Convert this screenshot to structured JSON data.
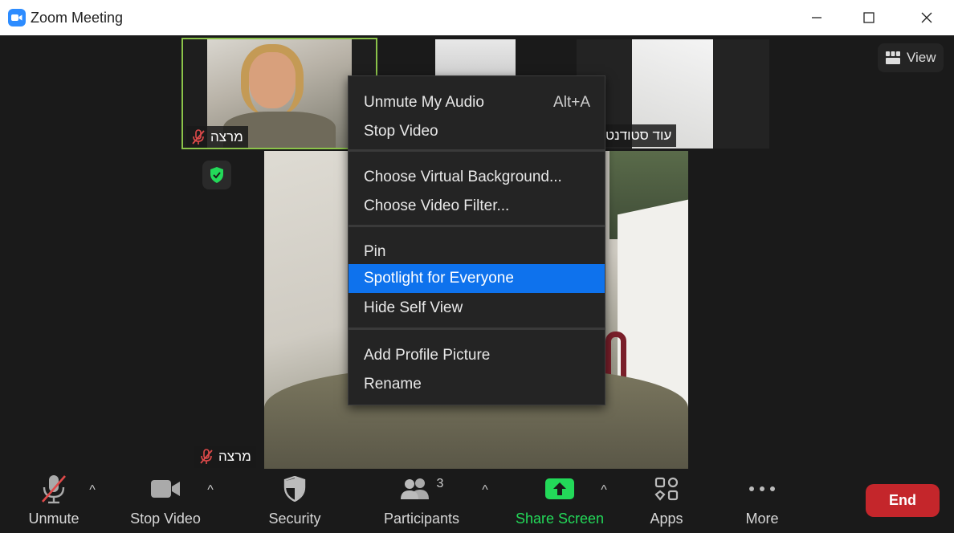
{
  "window": {
    "title": "Zoom Meeting",
    "minimize_glyph": "—",
    "maximize_glyph": "☐",
    "close_glyph": "✕"
  },
  "view_button": {
    "label": "View"
  },
  "participants": {
    "self_thumb_name": "מרצה",
    "other_thumb_name": "עוד סטודנט",
    "main_video_name": "מרצה"
  },
  "context_menu": {
    "groups": [
      [
        {
          "label": "Unmute My Audio",
          "shortcut": "Alt+A"
        },
        {
          "label": "Stop Video",
          "shortcut": ""
        }
      ],
      [
        {
          "label": "Choose Virtual Background...",
          "shortcut": ""
        },
        {
          "label": "Choose Video Filter...",
          "shortcut": ""
        }
      ],
      [
        {
          "label": "Pin",
          "shortcut": ""
        },
        {
          "label": "Spotlight for Everyone",
          "shortcut": "",
          "highlighted": true
        },
        {
          "label": "Hide Self View",
          "shortcut": ""
        }
      ],
      [
        {
          "label": "Add Profile Picture",
          "shortcut": ""
        },
        {
          "label": "Rename",
          "shortcut": ""
        }
      ]
    ]
  },
  "toolbar": {
    "unmute_label": "Unmute",
    "stop_video_label": "Stop Video",
    "security_label": "Security",
    "participants_label": "Participants",
    "participants_count": "3",
    "share_screen_label": "Share Screen",
    "apps_label": "Apps",
    "more_label": "More",
    "end_label": "End",
    "caret_glyph": "^"
  },
  "colors": {
    "accent_blue": "#0e72ed",
    "share_green": "#23d959",
    "end_red": "#c4262b",
    "active_speaker_border": "#8bc34a",
    "muted_red": "#e04a4a"
  }
}
